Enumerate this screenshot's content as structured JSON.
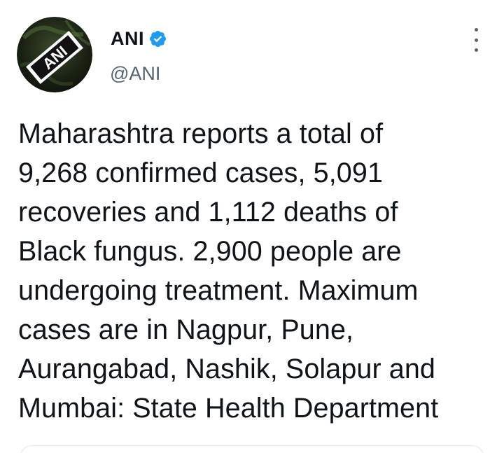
{
  "author": {
    "display_name": "ANI",
    "handle": "@ANI",
    "verified": true,
    "avatar_icon": "ani-logo-icon",
    "avatar_text": "ANI"
  },
  "tweet": {
    "lines": [
      "Maharashtra reports a total of",
      "9,268 confirmed cases, 5,091",
      "recoveries and 1,112 deaths of",
      "Black fungus. 2,900 people are",
      "undergoing treatment. Maximum",
      "cases are in Nagpur, Pune,",
      "Aurangabad, Nashik, Solapur and",
      "Mumbai: State Health Department"
    ]
  },
  "menu": {
    "icon": "more-vertical-icon"
  },
  "colors": {
    "text": "#0f1419",
    "secondary_text": "#536471",
    "verified_badge": "#1d9bf0",
    "card_border": "#e1e8ed"
  }
}
